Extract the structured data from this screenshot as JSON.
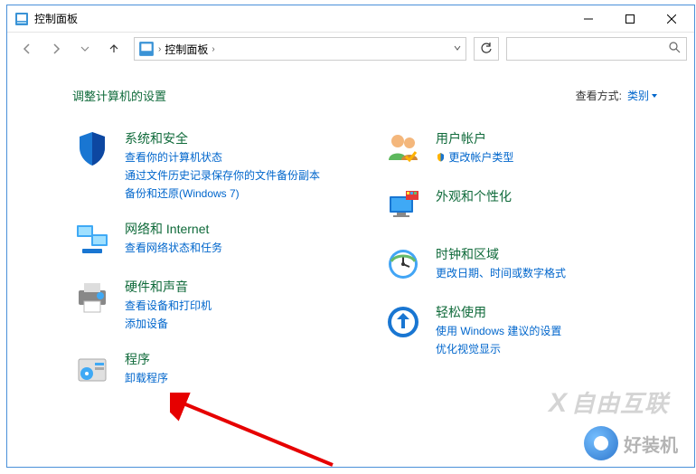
{
  "title": "控制面板",
  "breadcrumb": {
    "root": "控制面板"
  },
  "heading": "调整计算机的设置",
  "viewBy": {
    "label": "查看方式:",
    "value": "类别"
  },
  "left": [
    {
      "title": "系统和安全",
      "links": [
        "查看你的计算机状态",
        "通过文件历史记录保存你的文件备份副本",
        "备份和还原(Windows 7)"
      ]
    },
    {
      "title": "网络和 Internet",
      "links": [
        "查看网络状态和任务"
      ]
    },
    {
      "title": "硬件和声音",
      "links": [
        "查看设备和打印机",
        "添加设备"
      ]
    },
    {
      "title": "程序",
      "links": [
        "卸载程序"
      ]
    }
  ],
  "right": [
    {
      "title": "用户帐户",
      "links": [
        "更改帐户类型"
      ]
    },
    {
      "title": "外观和个性化",
      "links": []
    },
    {
      "title": "时钟和区域",
      "links": [
        "更改日期、时间或数字格式"
      ]
    },
    {
      "title": "轻松使用",
      "links": [
        "使用 Windows 建议的设置",
        "优化视觉显示"
      ]
    }
  ],
  "watermark1": "自由互联",
  "watermark2": "好装机"
}
